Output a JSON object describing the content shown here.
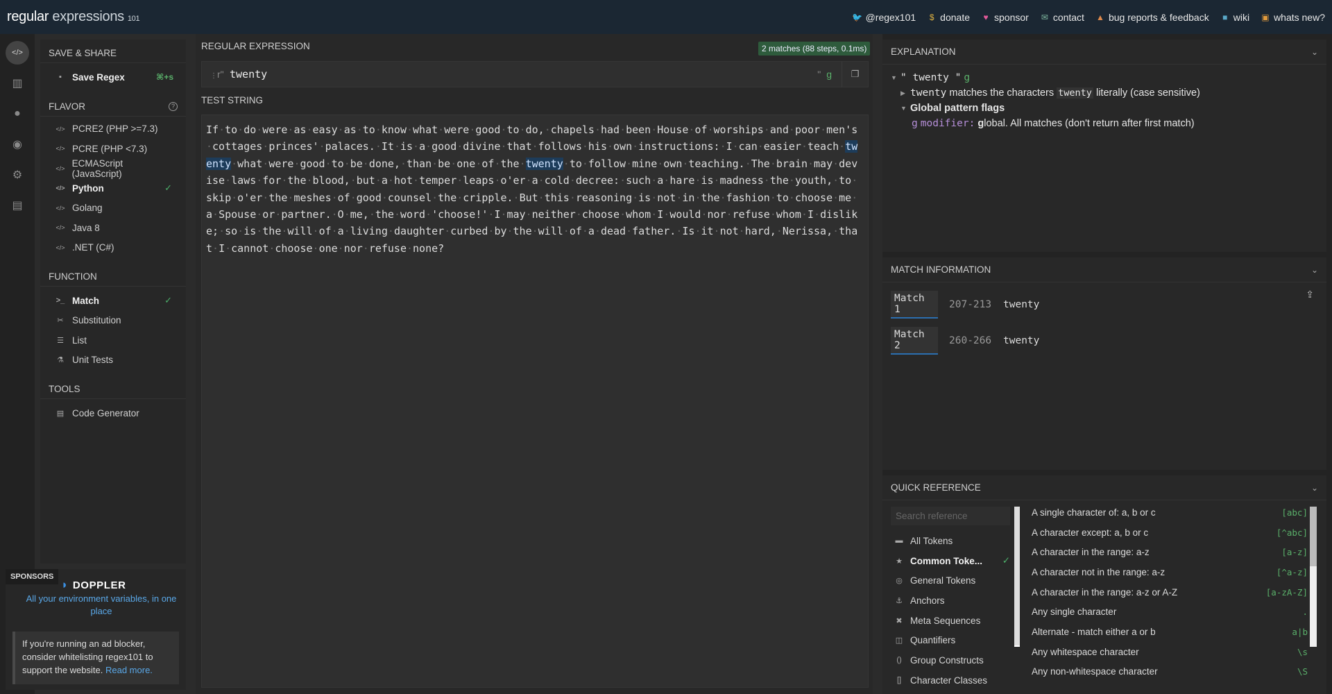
{
  "header": {
    "logo_main": "regular",
    "logo_light": "expressions",
    "logo_version": "101",
    "links": [
      {
        "icon": "twitter-icon",
        "glyph": "🐦",
        "color": "#5aa8e8",
        "label": "@regex101"
      },
      {
        "icon": "dollar-icon",
        "glyph": "$",
        "color": "#e0b341",
        "label": "donate"
      },
      {
        "icon": "heart-icon",
        "glyph": "♥",
        "color": "#e35a9a",
        "label": "sponsor"
      },
      {
        "icon": "mail-icon",
        "glyph": "✉",
        "color": "#7fb8a0",
        "label": "contact"
      },
      {
        "icon": "warning-icon",
        "glyph": "▲",
        "color": "#e08a4c",
        "label": "bug reports & feedback"
      },
      {
        "icon": "chat-icon",
        "glyph": "■",
        "color": "#5aa8c8",
        "label": "wiki"
      },
      {
        "icon": "news-icon",
        "glyph": "▣",
        "color": "#e09a3c",
        "label": "whats new?"
      }
    ]
  },
  "rail": [
    {
      "icon": "code-icon",
      "glyph": "</>"
    },
    {
      "icon": "library-icon",
      "glyph": "▥"
    },
    {
      "icon": "user-icon",
      "glyph": "●"
    },
    {
      "icon": "gamepad-icon",
      "glyph": "◉"
    },
    {
      "icon": "settings-icon",
      "glyph": "⚙"
    },
    {
      "icon": "chat-bubble-icon",
      "glyph": "▤"
    }
  ],
  "sidebar": {
    "save_share": {
      "title": "SAVE & SHARE",
      "save_label": "Save Regex",
      "shortcut": "⌘+s"
    },
    "flavor": {
      "title": "FLAVOR",
      "items": [
        "PCRE2 (PHP >=7.3)",
        "PCRE (PHP <7.3)",
        "ECMAScript (JavaScript)",
        "Python",
        "Golang",
        "Java 8",
        ".NET (C#)"
      ],
      "selected": "Python"
    },
    "function": {
      "title": "FUNCTION",
      "items": [
        {
          "label": "Match",
          "icon": "terminal-icon",
          "glyph": ">_"
        },
        {
          "label": "Substitution",
          "icon": "scissors-icon",
          "glyph": "✂"
        },
        {
          "label": "List",
          "icon": "list-icon",
          "glyph": "☰"
        },
        {
          "label": "Unit Tests",
          "icon": "flask-icon",
          "glyph": "⚗"
        }
      ],
      "selected": "Match"
    },
    "tools": {
      "title": "TOOLS",
      "items": [
        {
          "label": "Code Generator",
          "icon": "file-code-icon",
          "glyph": "▤"
        }
      ]
    }
  },
  "sponsor": {
    "label": "SPONSORS",
    "brand": "DOPPLER",
    "tagline": "All your environment variables, in one place",
    "adnote_text": "If you're running an ad blocker, consider whitelisting regex101 to support the website.",
    "adnote_link": "Read more."
  },
  "regex": {
    "title": "REGULAR EXPRESSION",
    "match_badge": "2 matches (88 steps, 0.1ms)",
    "prefix": "r\"",
    "value": "twenty",
    "suffix": "\"",
    "flags": "g"
  },
  "test": {
    "title": "TEST STRING",
    "segments": [
      {
        "t": "If·to·do·were·as·easy·as·to·know·what·were·good·to·do,·chapels·had·been·House·of·worships·and·poor·men's·cottages·princes'·palaces.·It·is·a·good·divine·that·follows·his·own·instructions:·I·can·easier·teach·"
      },
      {
        "t": "twenty",
        "hl": true
      },
      {
        "t": "·what·were·good·to·be·done,·than·be·one·of·the·"
      },
      {
        "t": "twenty",
        "hl": true
      },
      {
        "t": "·to·follow·mine·own·teaching.·The·brain·may·devise·laws·for·the·blood,·but·a·hot·temper·leaps·o'er·a·cold·decree:·such·a·hare·is·madness·the·youth,·to·skip·o'er·the·meshes·of·good·counsel·the·cripple.·But·this·reasoning·is·not·in·the·fashion·to·choose·me·a·Spouse·or·partner.·O·me,·the·word·'choose!'·I·may·neither·choose·whom·I·would·nor·refuse·whom·I·dislike;·so·is·the·will·of·a·living·daughter·curbed·by·the·will·of·a·dead·father.·Is·it·not·hard,·Nerissa,·that·I·cannot·choose·one·nor·refuse·none?"
      }
    ]
  },
  "explanation": {
    "title": "EXPLANATION",
    "root": "\" twenty \"",
    "root_flag": "g",
    "line1_tok": "twenty",
    "line1_mid": "matches the characters",
    "line1_tok2": "twenty",
    "line1_end": "literally (case sensitive)",
    "flags_title": "Global pattern flags",
    "flag_g": "g",
    "flag_mod": "modifier:",
    "flag_bold": "g",
    "flag_desc": "lobal. All matches (don't return after first match)"
  },
  "match_info": {
    "title": "MATCH INFORMATION",
    "matches": [
      {
        "name": "Match 1",
        "range": "207-213",
        "value": "twenty"
      },
      {
        "name": "Match 2",
        "range": "260-266",
        "value": "twenty"
      }
    ]
  },
  "quick_ref": {
    "title": "QUICK REFERENCE",
    "search_placeholder": "Search reference",
    "categories": [
      {
        "label": "All Tokens",
        "icon": "stack-icon",
        "glyph": "▬"
      },
      {
        "label": "Common Toke...",
        "icon": "star-icon",
        "glyph": "★"
      },
      {
        "label": "General Tokens",
        "icon": "circle-icon",
        "glyph": "◎"
      },
      {
        "label": "Anchors",
        "icon": "anchor-icon",
        "glyph": "⚓"
      },
      {
        "label": "Meta Sequences",
        "icon": "x-circle-icon",
        "glyph": "✖"
      },
      {
        "label": "Quantifiers",
        "icon": "book-icon",
        "glyph": "◫"
      },
      {
        "label": "Group Constructs",
        "icon": "parens-icon",
        "glyph": "()"
      },
      {
        "label": "Character Classes",
        "icon": "brackets-icon",
        "glyph": "[]"
      }
    ],
    "selected_category": "Common Toke...",
    "entries": [
      {
        "desc": "A single character of: a, b or c",
        "tok": "[abc]"
      },
      {
        "desc": "A character except: a, b or c",
        "tok": "[^abc]"
      },
      {
        "desc": "A character in the range: a-z",
        "tok": "[a-z]"
      },
      {
        "desc": "A character not in the range: a-z",
        "tok": "[^a-z]"
      },
      {
        "desc": "A character in the range: a-z or A-Z",
        "tok": "[a-zA-Z]"
      },
      {
        "desc": "Any single character",
        "tok": "."
      },
      {
        "desc": "Alternate - match either a or b",
        "tok": "a|b"
      },
      {
        "desc": "Any whitespace character",
        "tok": "\\s"
      },
      {
        "desc": "Any non-whitespace character",
        "tok": "\\S"
      }
    ]
  }
}
